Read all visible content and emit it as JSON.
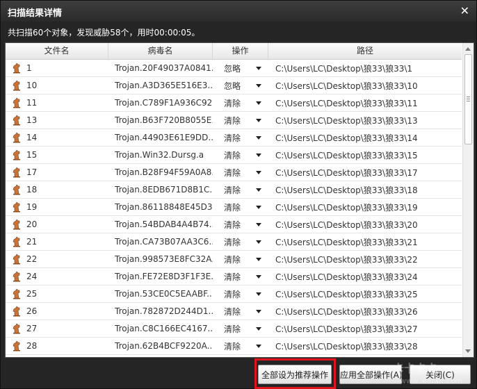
{
  "window": {
    "title": "扫描结果详情",
    "summary": "共扫描60个对象，发现威胁58个，用时00:00:05。"
  },
  "columns": [
    "文件名",
    "病毒名",
    "操作",
    "路径"
  ],
  "rows": [
    {
      "file": "1",
      "virus": "Trojan.20F49037A0841...",
      "action": "忽略",
      "path": "C:\\Users\\LC\\Desktop\\狼33\\狼33\\1"
    },
    {
      "file": "10",
      "virus": "Trojan.A3D365E516E3...",
      "action": "忽略",
      "path": "C:\\Users\\LC\\Desktop\\狼33\\狼33\\10"
    },
    {
      "file": "11",
      "virus": "Trojan.C789F1A936C92...",
      "action": "清除",
      "path": "C:\\Users\\LC\\Desktop\\狼33\\狼33\\11"
    },
    {
      "file": "13",
      "virus": "Trojan.B63F720B8055E...",
      "action": "清除",
      "path": "C:\\Users\\LC\\Desktop\\狼33\\狼33\\13"
    },
    {
      "file": "14",
      "virus": "Trojan.44903E61E9DD...",
      "action": "清除",
      "path": "C:\\Users\\LC\\Desktop\\狼33\\狼33\\14"
    },
    {
      "file": "15",
      "virus": "Trojan.Win32.Dursg.a",
      "action": "清除",
      "path": "C:\\Users\\LC\\Desktop\\狼33\\狼33\\15"
    },
    {
      "file": "17",
      "virus": "Trojan.B28F94F59A0A8...",
      "action": "清除",
      "path": "C:\\Users\\LC\\Desktop\\狼33\\狼33\\17"
    },
    {
      "file": "18",
      "virus": "Trojan.8EDB671D8B1C...",
      "action": "清除",
      "path": "C:\\Users\\LC\\Desktop\\狼33\\狼33\\18"
    },
    {
      "file": "19",
      "virus": "Trojan.86118848E45D3...",
      "action": "清除",
      "path": "C:\\Users\\LC\\Desktop\\狼33\\狼33\\19"
    },
    {
      "file": "20",
      "virus": "Trojan.54BDAB4A4B74...",
      "action": "清除",
      "path": "C:\\Users\\LC\\Desktop\\狼33\\狼33\\20"
    },
    {
      "file": "21",
      "virus": "Trojan.CA73B07AA3C6...",
      "action": "清除",
      "path": "C:\\Users\\LC\\Desktop\\狼33\\狼33\\21"
    },
    {
      "file": "22",
      "virus": "Trojan.998573E8FC32A...",
      "action": "清除",
      "path": "C:\\Users\\LC\\Desktop\\狼33\\狼33\\22"
    },
    {
      "file": "24",
      "virus": "Trojan.FE72E8D3F1F3E...",
      "action": "清除",
      "path": "C:\\Users\\LC\\Desktop\\狼33\\狼33\\24"
    },
    {
      "file": "25",
      "virus": "Trojan.53CE0C5EAABF...",
      "action": "清除",
      "path": "C:\\Users\\LC\\Desktop\\狼33\\狼33\\25"
    },
    {
      "file": "26",
      "virus": "Trojan.782872D244D1...",
      "action": "清除",
      "path": "C:\\Users\\LC\\Desktop\\狼33\\狼33\\26"
    },
    {
      "file": "27",
      "virus": "Trojan.C8C166EC4167...",
      "action": "清除",
      "path": "C:\\Users\\LC\\Desktop\\狼33\\狼33\\27"
    },
    {
      "file": "28",
      "virus": "Trojan.62B4BCF9220A...",
      "action": "清除",
      "path": "C:\\Users\\LC\\Desktop\\狼33\\狼33\\28"
    }
  ],
  "buttons": {
    "recommend": "全部设为推荐操作",
    "apply_all": "应用全部操作(A)",
    "close": "关闭(C)"
  },
  "icons": {
    "close": "close-icon",
    "file": "trojan-horse-icon",
    "dropdown": "dropdown-arrow-icon"
  },
  "colors": {
    "highlight_outline": "#e0141e",
    "title_bar": "#2a2a2a"
  },
  "watermark": "ikafan"
}
